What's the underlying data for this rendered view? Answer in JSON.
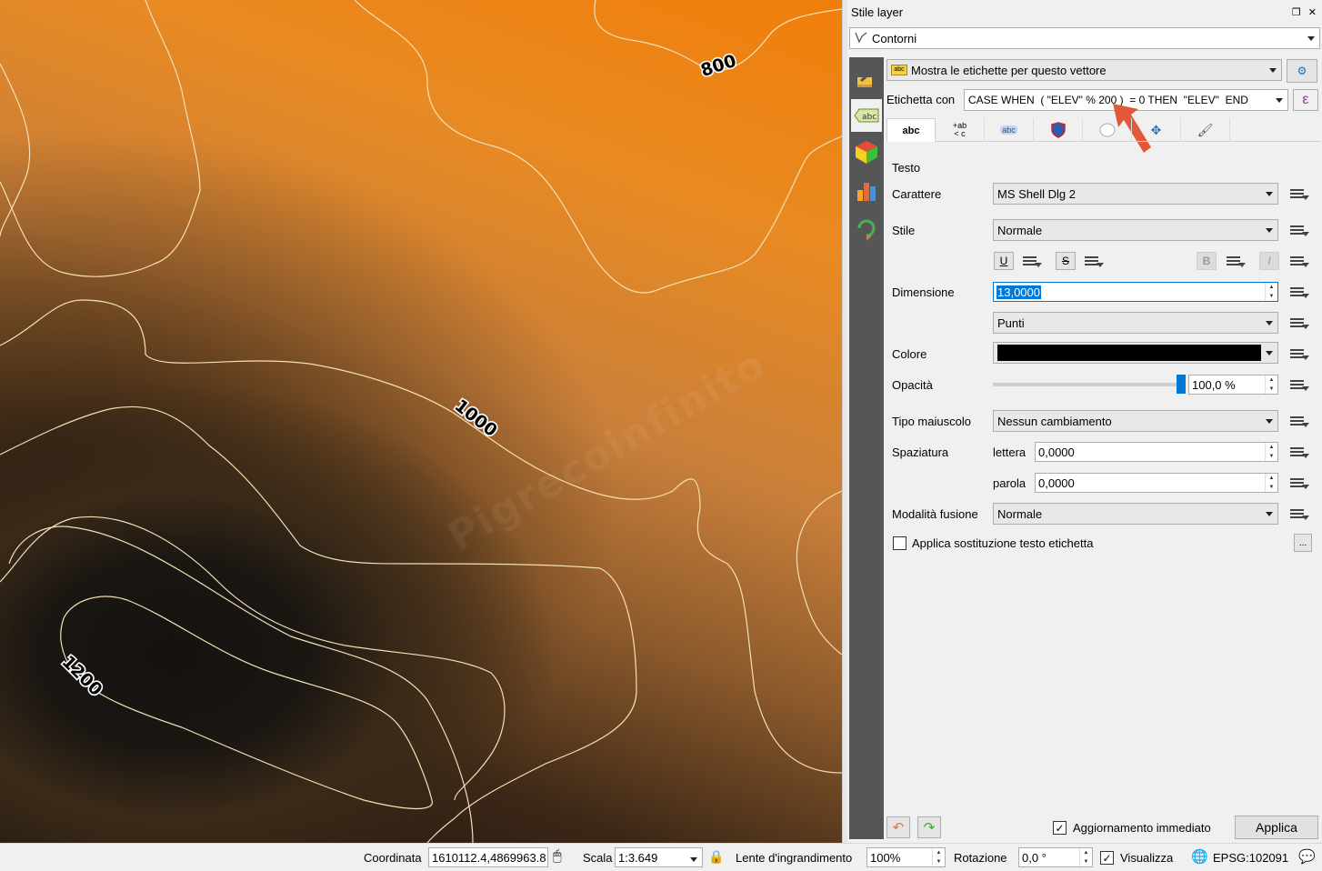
{
  "map": {
    "contour_labels": [
      "800",
      "1000",
      "1200"
    ],
    "watermark": "Pigrecoinfinito"
  },
  "panel": {
    "title": "Stile layer",
    "layer_name": "Contorni",
    "label_mode": "Mostra le etichette per questo vettore",
    "label_with_text": "Etichetta con",
    "label_expression": "CASE WHEN  ( \"ELEV\" % 200 )  = 0 THEN  \"ELEV\"  END",
    "tabs": [
      "abc",
      "ab/c",
      "abc",
      "shield",
      "bubble",
      "move",
      "brush"
    ],
    "section_title": "Testo",
    "font_label": "Carattere",
    "font_value": "MS Shell Dlg 2",
    "style_label": "Stile",
    "style_value": "Normale",
    "btn_u": "U",
    "btn_s": "S",
    "btn_b": "B",
    "btn_i": "I",
    "size_label": "Dimensione",
    "size_value": "13,0000",
    "unit_value": "Punti",
    "color_label": "Colore",
    "color_value": "#000000",
    "opacity_label": "Opacità",
    "opacity_value": "100,0 %",
    "opacity_fraction": 1.0,
    "case_label": "Tipo maiuscolo",
    "case_value": "Nessun cambiamento",
    "spacing_label": "Spaziatura",
    "letter_label": "lettera",
    "letter_value": "0,0000",
    "word_label": "parola",
    "word_value": "0,0000",
    "blend_label": "Modalità fusione",
    "blend_value": "Normale",
    "substitute_label": "Applica sostituzione testo etichetta",
    "substitute_checked": false,
    "more_btn": "...",
    "live_update_label": "Aggiornamento immediato",
    "live_update_checked": true,
    "apply_label": "Applica",
    "sidebar_icons": [
      "paintbrush-icon",
      "labels-icon",
      "3d-cube-icon",
      "diagram-icon",
      "history-icon"
    ]
  },
  "statusbar": {
    "coord_label": "Coordinata",
    "coord_value": "1610112.4,4869963.8",
    "scale_label": "Scala",
    "scale_value": "1:3.649",
    "magnifier_label": "Lente d'ingrandimento",
    "magnifier_value": "100%",
    "rotation_label": "Rotazione",
    "rotation_value": "0,0 °",
    "render_label": "Visualizza",
    "render_checked": true,
    "crs_label": "EPSG:102091"
  },
  "colors": {
    "accent_arrow": "#e05a3a",
    "selection": "#0078d7",
    "sidebar": "#565656"
  }
}
